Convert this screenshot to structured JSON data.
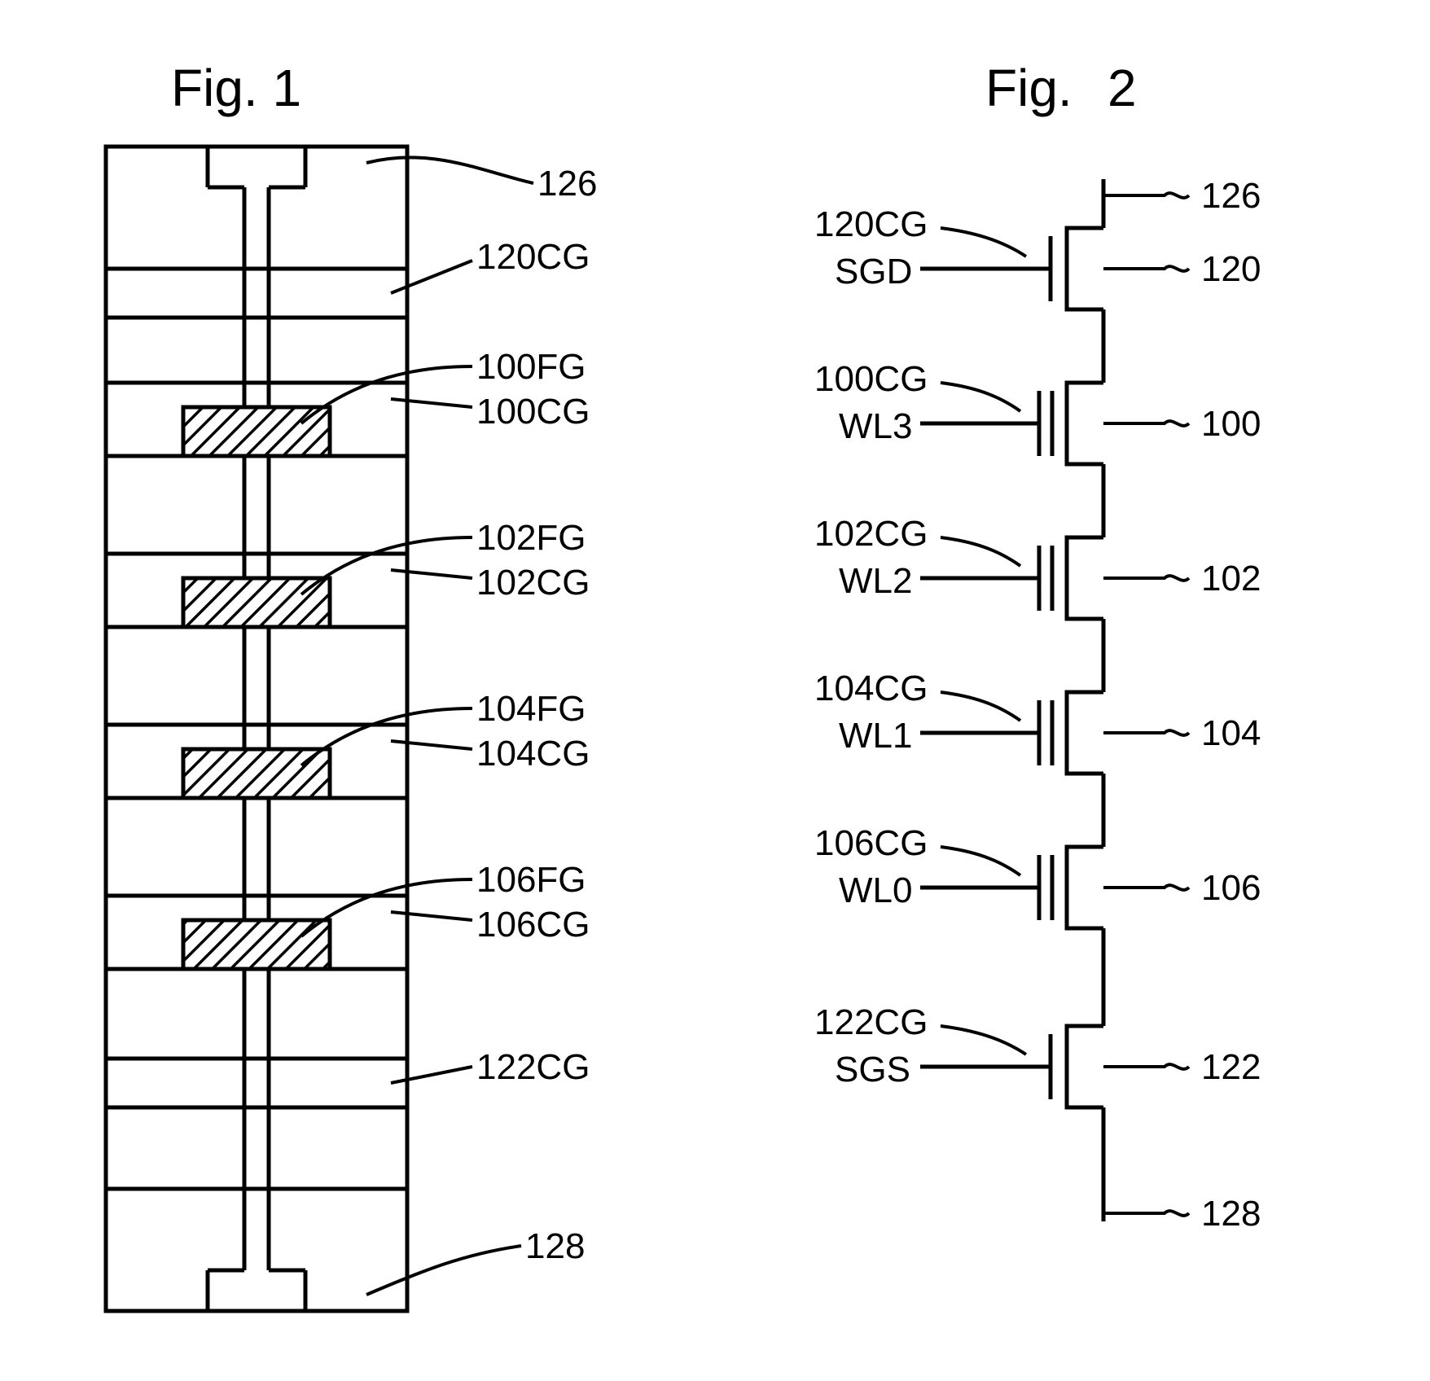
{
  "fig1": {
    "title": "Fig. 1",
    "labels": {
      "t126": "126",
      "t120cg": "120CG",
      "t100fg": "100FG",
      "t100cg": "100CG",
      "t102fg": "102FG",
      "t102cg": "102CG",
      "t104fg": "104FG",
      "t104cg": "104CG",
      "t106fg": "106FG",
      "t106cg": "106CG",
      "t122cg": "122CG",
      "t128": "128"
    }
  },
  "fig2": {
    "title_1": "Fig.",
    "title_2": "2",
    "left": {
      "t120cg": "120CG",
      "sgd": "SGD",
      "t100cg": "100CG",
      "wl3": "WL3",
      "t102cg": "102CG",
      "wl2": "WL2",
      "t104cg": "104CG",
      "wl1": "WL1",
      "t106cg": "106CG",
      "wl0": "WL0",
      "t122cg": "122CG",
      "sgs": "SGS"
    },
    "right": {
      "t126": "126",
      "t120": "120",
      "t100": "100",
      "t102": "102",
      "t104": "104",
      "t106": "106",
      "t122": "122",
      "t128": "128"
    }
  }
}
